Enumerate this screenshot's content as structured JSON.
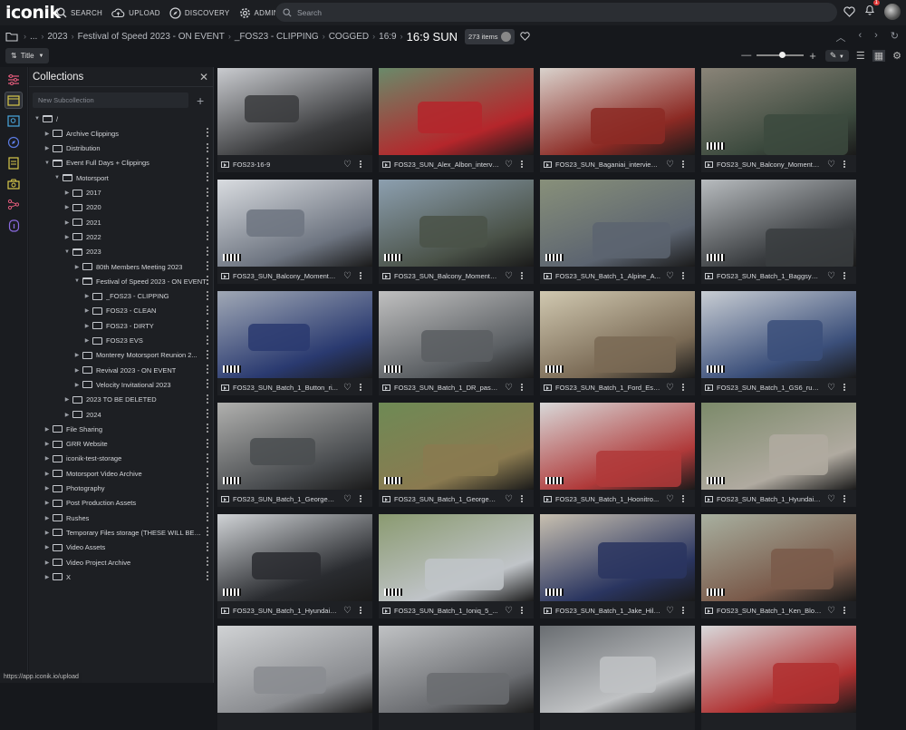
{
  "app": {
    "logo": "iconik"
  },
  "nav": [
    {
      "label": "SEARCH",
      "icon": "search-icon"
    },
    {
      "label": "UPLOAD",
      "icon": "cloud-upload-icon"
    },
    {
      "label": "DISCOVERY",
      "icon": "compass-icon"
    },
    {
      "label": "ADMIN",
      "icon": "gear-icon"
    }
  ],
  "search": {
    "placeholder": "Search"
  },
  "notifications": {
    "count": "1"
  },
  "breadcrumb": {
    "items": [
      "...",
      "2023",
      "Festival of Speed 2023 - ON EVENT",
      "_FOS23 - CLIPPING",
      "COGGED",
      "16:9"
    ],
    "current": "16:9 SUN",
    "count": "273 items"
  },
  "toolbar": {
    "sort_label": "Title"
  },
  "panel": {
    "title": "Collections",
    "new_sub_placeholder": "New Subcollection",
    "tree": [
      {
        "label": "/",
        "depth": 0,
        "open": true
      },
      {
        "label": "Archive Clippings",
        "depth": 1,
        "open": false
      },
      {
        "label": "Distribution",
        "depth": 1,
        "open": false
      },
      {
        "label": "Event Full Days + Clippings",
        "depth": 1,
        "open": true
      },
      {
        "label": "Motorsport",
        "depth": 2,
        "open": true
      },
      {
        "label": "2017",
        "depth": 3,
        "open": false
      },
      {
        "label": "2020",
        "depth": 3,
        "open": false
      },
      {
        "label": "2021",
        "depth": 3,
        "open": false
      },
      {
        "label": "2022",
        "depth": 3,
        "open": false
      },
      {
        "label": "2023",
        "depth": 3,
        "open": true
      },
      {
        "label": "80th Members Meeting 2023",
        "depth": 4,
        "open": false
      },
      {
        "label": "Festival of Speed 2023 - ON EVENT",
        "depth": 4,
        "open": true
      },
      {
        "label": "_FOS23 - CLIPPING",
        "depth": 5,
        "open": false
      },
      {
        "label": "FOS23 - CLEAN",
        "depth": 5,
        "open": false
      },
      {
        "label": "FOS23 - DIRTY",
        "depth": 5,
        "open": false
      },
      {
        "label": "FOS23 EVS",
        "depth": 5,
        "open": false
      },
      {
        "label": "Monterey Motorsport Reunion 2...",
        "depth": 4,
        "open": false
      },
      {
        "label": "Revival 2023 - ON EVENT",
        "depth": 4,
        "open": false
      },
      {
        "label": "Velocity Invitational 2023",
        "depth": 4,
        "open": false
      },
      {
        "label": "2023 TO BE DELETED",
        "depth": 3,
        "open": false
      },
      {
        "label": "2024",
        "depth": 3,
        "open": false
      },
      {
        "label": "File Sharing",
        "depth": 1,
        "open": false
      },
      {
        "label": "GRR Website",
        "depth": 1,
        "open": false
      },
      {
        "label": "iconik-test-storage",
        "depth": 1,
        "open": false
      },
      {
        "label": "Motorsport Video Archive",
        "depth": 1,
        "open": false
      },
      {
        "label": "Photography",
        "depth": 1,
        "open": false
      },
      {
        "label": "Post Production Assets",
        "depth": 1,
        "open": false
      },
      {
        "label": "Rushes",
        "depth": 1,
        "open": false
      },
      {
        "label": "Temporary Files storage (THESE WILL BE D...",
        "depth": 1,
        "open": false
      },
      {
        "label": "Video Assets",
        "depth": 1,
        "open": false
      },
      {
        "label": "Video Project Archive",
        "depth": 1,
        "open": false
      },
      {
        "label": "X",
        "depth": 1,
        "open": false
      }
    ]
  },
  "assets": [
    {
      "name": "FOS23-16-9",
      "colors": [
        "#c9cbcf",
        "#3a3b3d"
      ]
    },
    {
      "name": "FOS23_SUN_Alex_Albon_intervi...",
      "colors": [
        "#6a8a6a",
        "#b5262b"
      ]
    },
    {
      "name": "FOS23_SUN_Baganiai_interview...",
      "colors": [
        "#d9d2cc",
        "#8c2a24"
      ]
    },
    {
      "name": "FOS23_SUN_Balcony_Moment_...",
      "colors": [
        "#8a8478",
        "#3c4a3e"
      ]
    },
    {
      "name": "FOS23_SUN_Balcony_Moment_...",
      "colors": [
        "#d9dce0",
        "#6d7480"
      ]
    },
    {
      "name": "FOS23_SUN_Balcony_Moment_...",
      "colors": [
        "#8da0b0",
        "#4a5248"
      ]
    },
    {
      "name": "FOS23_SUN_Batch_1_Alpine_A...",
      "colors": [
        "#88907a",
        "#5c6470"
      ]
    },
    {
      "name": "FOS23_SUN_Batch_1_Baggsy_d...",
      "colors": [
        "#b8bcbf",
        "#3a3d40"
      ]
    },
    {
      "name": "FOS23_SUN_Batch_1_Button_ri...",
      "colors": [
        "#a0a8b5",
        "#2a3a70"
      ]
    },
    {
      "name": "FOS23_SUN_Batch_1_DR_passe...",
      "colors": [
        "#c0c0c0",
        "#5a5e62"
      ]
    },
    {
      "name": "FOS23_SUN_Batch_1_Ford_Esc...",
      "colors": [
        "#d0c8b0",
        "#7a6a55"
      ]
    },
    {
      "name": "FOS23_SUN_Batch_1_GS6_run_...",
      "colors": [
        "#c8cdd3",
        "#3b4f7a"
      ]
    },
    {
      "name": "FOS23_SUN_Batch_1_George_B...",
      "colors": [
        "#b0b0ae",
        "#4a4d50"
      ]
    },
    {
      "name": "FOS23_SUN_Batch_1_George_B...",
      "colors": [
        "#6e8a55",
        "#8a7a50"
      ]
    },
    {
      "name": "FOS23_SUN_Batch_1_Hoonitro...",
      "colors": [
        "#d8d8d8",
        "#b03a3a"
      ]
    },
    {
      "name": "FOS23_SUN_Batch_1_Hyundai_...",
      "colors": [
        "#7c8a6a",
        "#b0aaa0"
      ]
    },
    {
      "name": "FOS23_SUN_Batch_1_Hyundai_...",
      "colors": [
        "#d0d3d6",
        "#2a2c30"
      ]
    },
    {
      "name": "FOS23_SUN_Batch_1_Ioniq_5_...",
      "colors": [
        "#8a9a70",
        "#c0c4c8"
      ]
    },
    {
      "name": "FOS23_SUN_Batch_1_Jake_Hill...",
      "colors": [
        "#c8c0b0",
        "#2a3560"
      ]
    },
    {
      "name": "FOS23_SUN_Batch_1_Ken_Bloc...",
      "colors": [
        "#a8b0a0",
        "#7a5a4a"
      ]
    },
    {
      "name": "",
      "colors": [
        "#d0d2d4",
        "#8a8c90"
      ]
    },
    {
      "name": "",
      "colors": [
        "#c0c2c4",
        "#6a6c70"
      ]
    },
    {
      "name": "",
      "colors": [
        "#6a6e72",
        "#c0c2c4"
      ]
    },
    {
      "name": "",
      "colors": [
        "#d8d8da",
        "#b03030"
      ]
    }
  ],
  "status": {
    "url": "https://app.iconik.io/upload"
  }
}
